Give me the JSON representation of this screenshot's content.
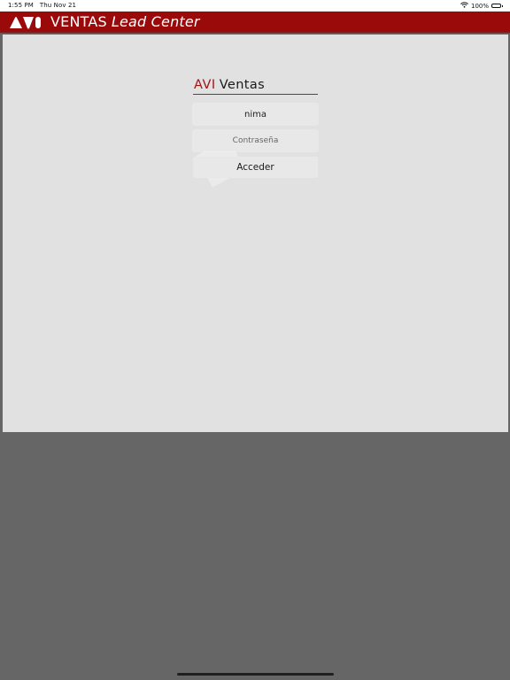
{
  "status_bar": {
    "time": "1:55 PM",
    "date": "Thu Nov 21",
    "battery": "100%",
    "wifi_icon": "wifi-icon",
    "battery_icon": "battery-icon"
  },
  "header": {
    "logo_icon": "avi-logo-icon",
    "title_main": "VENTAS",
    "title_sub": "Lead Center",
    "background_color": "#9b0a0a"
  },
  "login": {
    "brand_prefix": "AVI",
    "brand_suffix": "Ventas",
    "username_value": "nima",
    "password_placeholder": "Contraseña",
    "submit_label": "Acceder",
    "brand_accent_color": "#a31313"
  },
  "colors": {
    "panel": "#e1e1e1",
    "backdrop": "#666666"
  }
}
